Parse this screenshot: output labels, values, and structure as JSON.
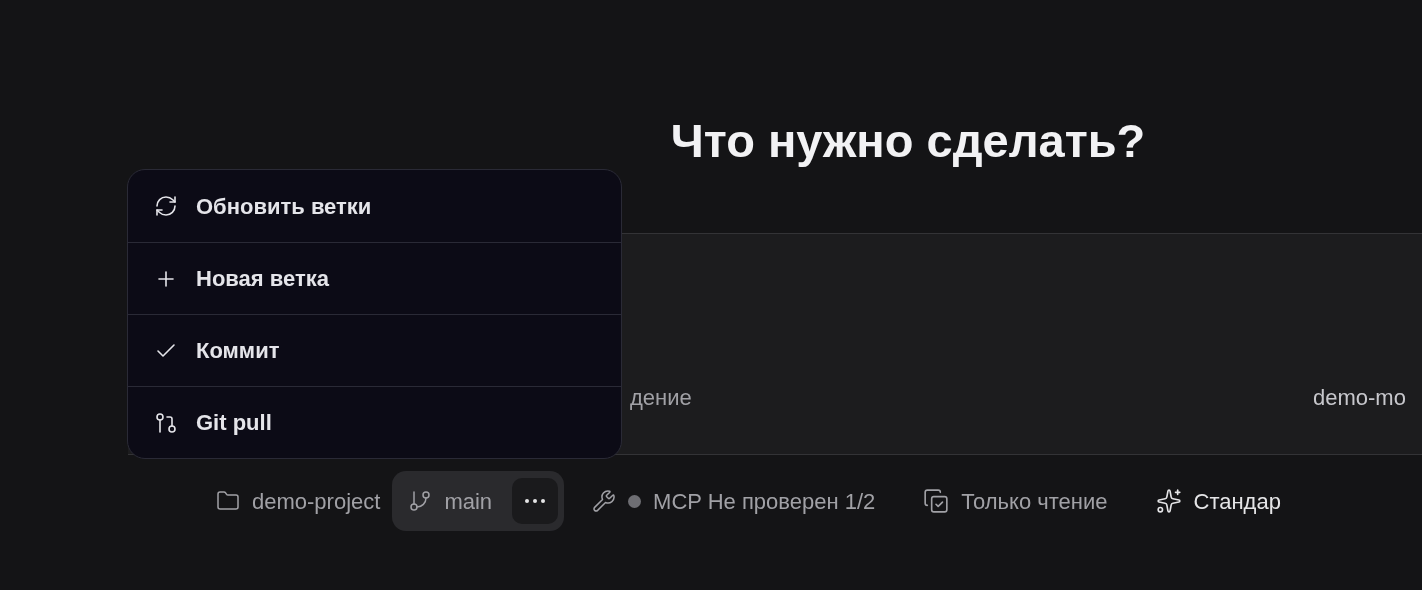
{
  "heading": "Что нужно сделать?",
  "composer": {
    "left_text": "дение",
    "right_text": "demo-mo"
  },
  "toolbar": [
    {
      "kind": "folder",
      "label": "demo-project"
    },
    {
      "kind": "branch",
      "label": "main",
      "menu_open": true
    },
    {
      "kind": "mcp",
      "label": "MCP Не проверен 1/2"
    },
    {
      "kind": "readonly",
      "label": "Только чтение"
    },
    {
      "kind": "mode",
      "label": "Стандар"
    }
  ],
  "branch_menu": [
    {
      "kind": "refresh",
      "label": "Обновить ветки"
    },
    {
      "kind": "new",
      "label": "Новая ветка"
    },
    {
      "kind": "commit",
      "label": "Коммит"
    },
    {
      "kind": "pull",
      "label": "Git pull"
    }
  ]
}
